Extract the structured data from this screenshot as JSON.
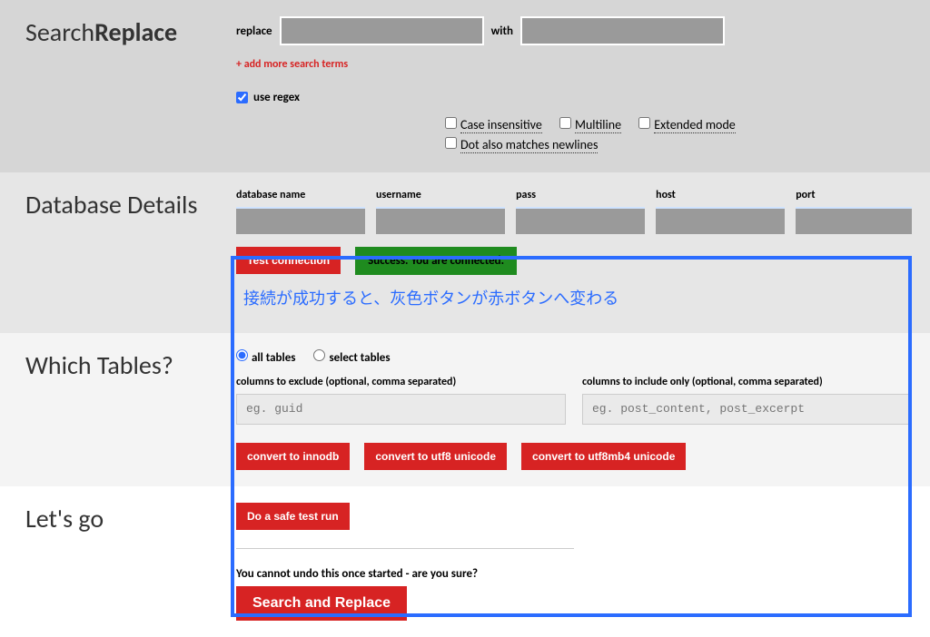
{
  "logo": {
    "part1": "Search",
    "part2": "Replace"
  },
  "replace": {
    "label_replace": "replace",
    "label_with": "with",
    "add_more": "+ add more search terms",
    "use_regex_label": "use regex",
    "opt_case": "Case insensitive",
    "opt_multiline": "Multiline",
    "opt_extended": "Extended mode",
    "opt_dotall": "Dot also matches newlines"
  },
  "db": {
    "section_title": "Database Details",
    "name_label": "database name",
    "user_label": "username",
    "pass_label": "pass",
    "host_label": "host",
    "port_label": "port",
    "test_btn": "Test connection",
    "success_msg": "Success. You are connected."
  },
  "annotation_text": "接続が成功すると、灰色ボタンが赤ボタンへ変わる",
  "tables": {
    "section_title": "Which Tables?",
    "all_label": "all tables",
    "select_label": "select tables",
    "exclude_label": "columns to exclude (optional, comma separated)",
    "exclude_placeholder": "eg. guid",
    "include_label": "columns to include only (optional, comma separated)",
    "include_placeholder": "eg. post_content, post_excerpt",
    "convert_innodb": "convert to innodb",
    "convert_utf8": "convert to utf8 unicode",
    "convert_utf8mb4": "convert to utf8mb4 unicode"
  },
  "go": {
    "section_title": "Let's go",
    "safe_run": "Do a safe test run",
    "warning": "You cannot undo this once started - are you sure?",
    "submit": "Search and Replace"
  }
}
